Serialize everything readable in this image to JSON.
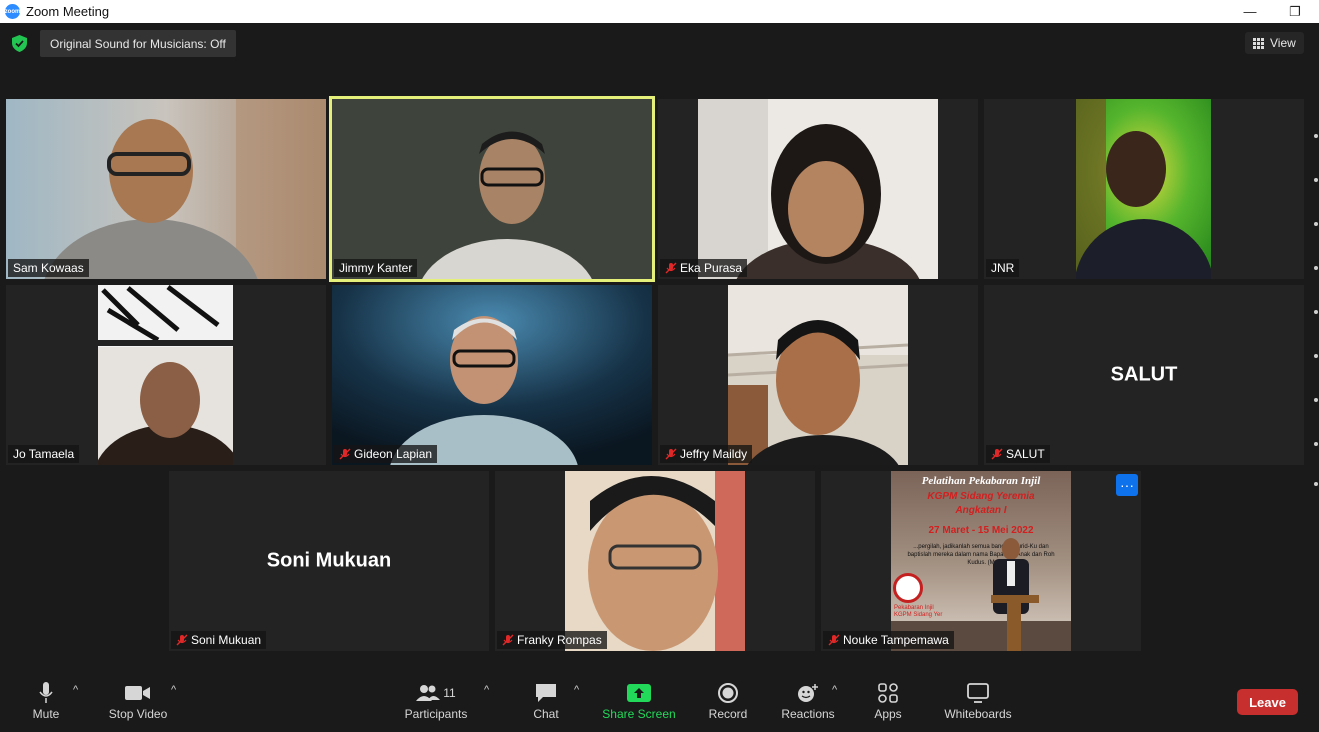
{
  "window": {
    "title": "Zoom Meeting",
    "minimize": "—",
    "restore": "❐"
  },
  "topbar": {
    "original_sound": "Original Sound for Musicians: Off",
    "view_label": "View"
  },
  "participants": [
    {
      "name": "Sam Kowaas",
      "muted": false,
      "video": true
    },
    {
      "name": "Jimmy Kanter",
      "muted": false,
      "video": true,
      "active_speaker": true
    },
    {
      "name": "Eka Purasa",
      "muted": true,
      "video": true
    },
    {
      "name": "JNR",
      "muted": false,
      "video": true
    },
    {
      "name": "Jo Tamaela",
      "muted": false,
      "video": true
    },
    {
      "name": "Gideon Lapian",
      "muted": true,
      "video": true
    },
    {
      "name": "Jeffry Maildy",
      "muted": true,
      "video": true
    },
    {
      "name": "SALUT",
      "muted": true,
      "video": false,
      "display": "SALUT"
    },
    {
      "name": "Soni Mukuan",
      "muted": true,
      "video": false,
      "display": "Soni Mukuan"
    },
    {
      "name": "Franky Rompas",
      "muted": true,
      "video": true
    },
    {
      "name": "Nouke Tampemawa",
      "muted": true,
      "video": true
    }
  ],
  "shared_slide": {
    "line1": "Pelatihan Pekabaran Injil",
    "line2": "KGPM Sidang Yeremia",
    "line3": "Angkatan I",
    "line4": "27 Maret - 15 Mei 2022",
    "verse": "...pergilah, jadikanlah semua bangsa murid-Ku dan baptislah mereka dalam nama Bapa dan Anak dan Roh Kudus. (M",
    "footer1": "Pekabaran Injil",
    "footer2": "KGPM Sidang Yer"
  },
  "toolbar": {
    "mute": "Mute",
    "stop_video": "Stop Video",
    "participants": "Participants",
    "participants_count": "11",
    "chat": "Chat",
    "share_screen": "Share Screen",
    "record": "Record",
    "reactions": "Reactions",
    "apps": "Apps",
    "whiteboards": "Whiteboards",
    "leave": "Leave"
  },
  "colors": {
    "active_speaker": "#e5f07a",
    "share_green": "#23d959",
    "leave_red": "#c72e2e",
    "accent_blue": "#0e72ed",
    "mute_red": "#e02828"
  }
}
